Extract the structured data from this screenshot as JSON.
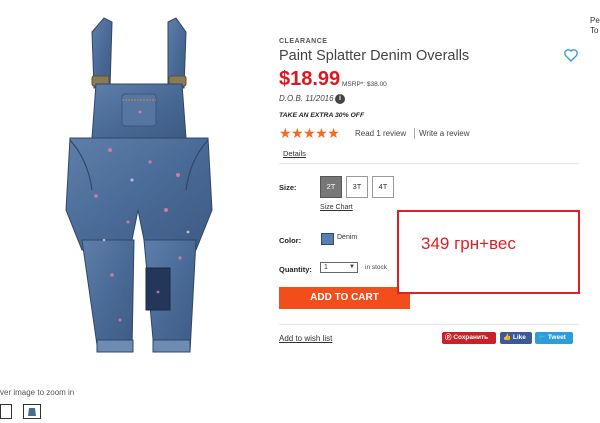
{
  "product": {
    "badge": "CLEARANCE",
    "title": "Paint Splatter Denim Overalls",
    "price": "$18.99",
    "msrp": "MSRP*: $38.00",
    "dob": "D.O.B. 11/2016",
    "dob_badge": "i",
    "promo": "TAKE AN EXTRA 30% OFF",
    "rating": 5,
    "stars": "★★★★★",
    "read_reviews": "Read 1 review",
    "write_review": "Write a review",
    "details": "Details"
  },
  "options": {
    "size_label": "Size:",
    "sizes": [
      "2T",
      "3T",
      "4T"
    ],
    "selected_size": "2T",
    "size_chart": "Size Chart",
    "color_label": "Color:",
    "color_name": "Denim",
    "quantity_label": "Quantity:",
    "quantity_value": "1",
    "stock_status": "in stock"
  },
  "actions": {
    "add_to_cart": "ADD TO CART",
    "add_to_wishlist": "Add to wish list",
    "pinterest": "Сохранить",
    "facebook": "Like",
    "twitter": "Tweet"
  },
  "gallery": {
    "zoom_hint": "ver image to zoom in"
  },
  "annotation": {
    "text": "349 грн+вес"
  },
  "edge_text": [
    "Pe",
    "To"
  ],
  "colors": {
    "price_red": "#e0171f",
    "cart_orange": "#f24e1c",
    "star_orange": "#f26b1d",
    "link_blue": "#2c9dd9"
  }
}
